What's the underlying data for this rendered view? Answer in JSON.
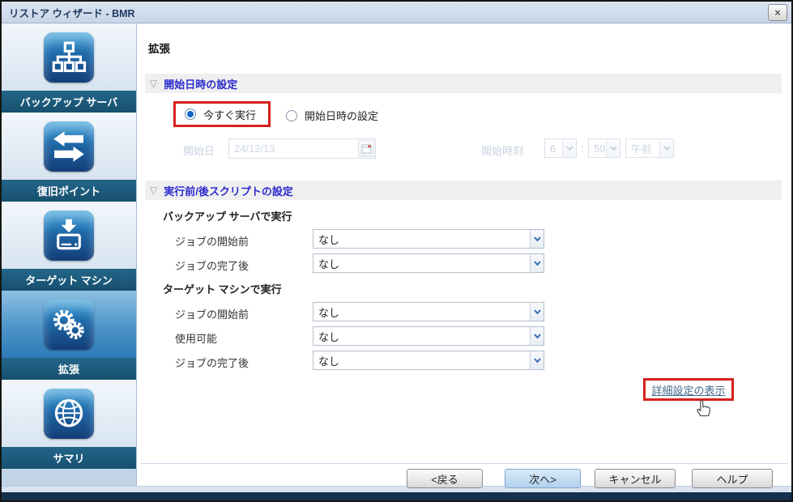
{
  "window": {
    "title": "リストア ウィザード - BMR",
    "close_glyph": "×"
  },
  "colors": {
    "highlight_red": "#D5211E",
    "step_label_navy": "#17506F",
    "section_title_blue": "#2B2BCD",
    "link_blue": "#44688C",
    "next_button_blue": "#C2DCF3",
    "icon_blue": "#1E68A8"
  },
  "sidebar": {
    "steps": [
      {
        "label": "バックアップ サーバ",
        "icon": "network-tree-icon",
        "active": false
      },
      {
        "label": "復旧ポイント",
        "icon": "sync-arrows-icon",
        "active": false
      },
      {
        "label": "ターゲット マシン",
        "icon": "restore-disk-icon",
        "active": false
      },
      {
        "label": "拡張",
        "icon": "gears-icon",
        "active": true
      },
      {
        "label": "サマリ",
        "icon": "globe-icon",
        "active": false
      }
    ]
  },
  "main": {
    "page_title": "拡張",
    "schedule_section": {
      "collapse_icon": "▽",
      "title": "開始日時の設定",
      "radio_run_now": {
        "label": "今すぐ実行",
        "selected": true
      },
      "radio_schedule": {
        "label": "開始日時の設定",
        "selected": false
      },
      "start_date": {
        "label": "開始日",
        "value": "24/12/13",
        "disabled": true
      },
      "start_time": {
        "label": "開始時刻",
        "hour": "6",
        "separator": ":",
        "minute": "50",
        "ampm": "午前",
        "disabled": true
      }
    },
    "scripts_section": {
      "collapse_icon": "▽",
      "title": "実行前/後スクリプトの設定",
      "backup_server": {
        "heading": "バックアップ サーバで実行",
        "rows": [
          {
            "label": "ジョブの開始前",
            "value": "なし"
          },
          {
            "label": "ジョブの完了後",
            "value": "なし"
          }
        ]
      },
      "target_machine": {
        "heading": "ターゲット マシンで実行",
        "rows": [
          {
            "label": "ジョブの開始前",
            "value": "なし"
          },
          {
            "label": "使用可能",
            "value": "なし"
          },
          {
            "label": "ジョブの完了後",
            "value": "なし"
          }
        ]
      }
    },
    "advanced_link": "詳細設定の表示"
  },
  "footer": {
    "back": "<戻る",
    "next": "次へ>",
    "cancel": "キャンセル",
    "help": "ヘルプ"
  }
}
